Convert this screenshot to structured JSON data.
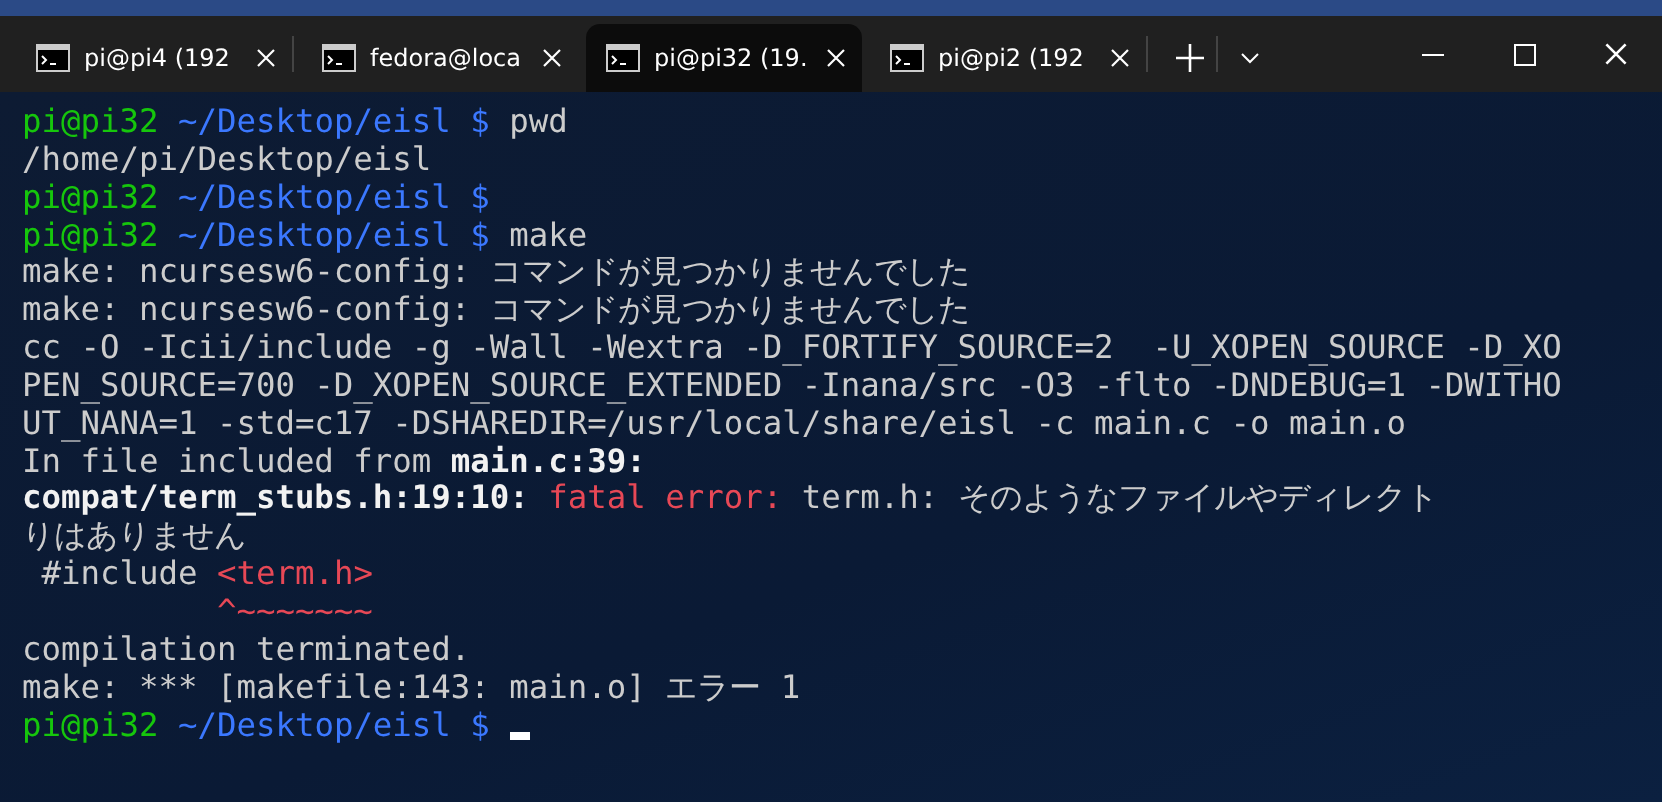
{
  "tabs": [
    {
      "title": "pi@pi4 (192",
      "selected": false
    },
    {
      "title": "fedora@loca",
      "selected": false
    },
    {
      "title": "pi@pi32 (19.",
      "selected": true
    },
    {
      "title": "pi@pi2 (192",
      "selected": false
    }
  ],
  "terminal": {
    "cursor": true,
    "lines": [
      {
        "segments": [
          {
            "kind": "user",
            "text": "pi@pi32"
          },
          {
            "kind": "path",
            "text": " ~/Desktop/eisl $"
          },
          {
            "kind": "plain",
            "text": " pwd"
          }
        ]
      },
      {
        "segments": [
          {
            "kind": "plain",
            "text": "/home/pi/Desktop/eisl"
          }
        ]
      },
      {
        "segments": [
          {
            "kind": "user",
            "text": "pi@pi32"
          },
          {
            "kind": "path",
            "text": " ~/Desktop/eisl $"
          }
        ]
      },
      {
        "segments": [
          {
            "kind": "user",
            "text": "pi@pi32"
          },
          {
            "kind": "path",
            "text": " ~/Desktop/eisl $"
          },
          {
            "kind": "plain",
            "text": " make"
          }
        ]
      },
      {
        "segments": [
          {
            "kind": "plain",
            "text": "make: ncursesw6-config: コマンドが見つかりませんでした"
          }
        ]
      },
      {
        "segments": [
          {
            "kind": "plain",
            "text": "make: ncursesw6-config: コマンドが見つかりませんでした"
          }
        ]
      },
      {
        "segments": [
          {
            "kind": "plain",
            "text": "cc -O -Icii/include -g -Wall -Wextra -D_FORTIFY_SOURCE=2  -U_XOPEN_SOURCE -D_XO"
          }
        ]
      },
      {
        "segments": [
          {
            "kind": "plain",
            "text": "PEN_SOURCE=700 -D_XOPEN_SOURCE_EXTENDED -Inana/src -O3 -flto -DNDEBUG=1 -DWITHO"
          }
        ]
      },
      {
        "segments": [
          {
            "kind": "plain",
            "text": "UT_NANA=1 -std=c17 -DSHAREDIR=/usr/local/share/eisl -c main.c -o main.o"
          }
        ]
      },
      {
        "segments": [
          {
            "kind": "plain",
            "text": "In file included from "
          },
          {
            "kind": "bold",
            "text": "main.c:39:"
          }
        ]
      },
      {
        "segments": [
          {
            "kind": "bold",
            "text": "compat/term_stubs.h:19:10: "
          },
          {
            "kind": "error",
            "text": "fatal error: "
          },
          {
            "kind": "plain",
            "text": "term.h: そのようなファイルやディレクト"
          }
        ]
      },
      {
        "segments": [
          {
            "kind": "plain",
            "text": "りはありません"
          }
        ]
      },
      {
        "segments": [
          {
            "kind": "plain",
            "text": " #include "
          },
          {
            "kind": "error",
            "text": "<term.h>"
          }
        ]
      },
      {
        "segments": [
          {
            "kind": "error",
            "text": "          ^~~~~~~~"
          }
        ]
      },
      {
        "segments": [
          {
            "kind": "plain",
            "text": "compilation terminated."
          }
        ]
      },
      {
        "segments": [
          {
            "kind": "plain",
            "text": "make: *** [makefile:143: main.o] エラー 1"
          }
        ]
      },
      {
        "segments": [
          {
            "kind": "user",
            "text": "pi@pi32"
          },
          {
            "kind": "path",
            "text": " ~/Desktop/eisl $"
          }
        ]
      }
    ]
  }
}
